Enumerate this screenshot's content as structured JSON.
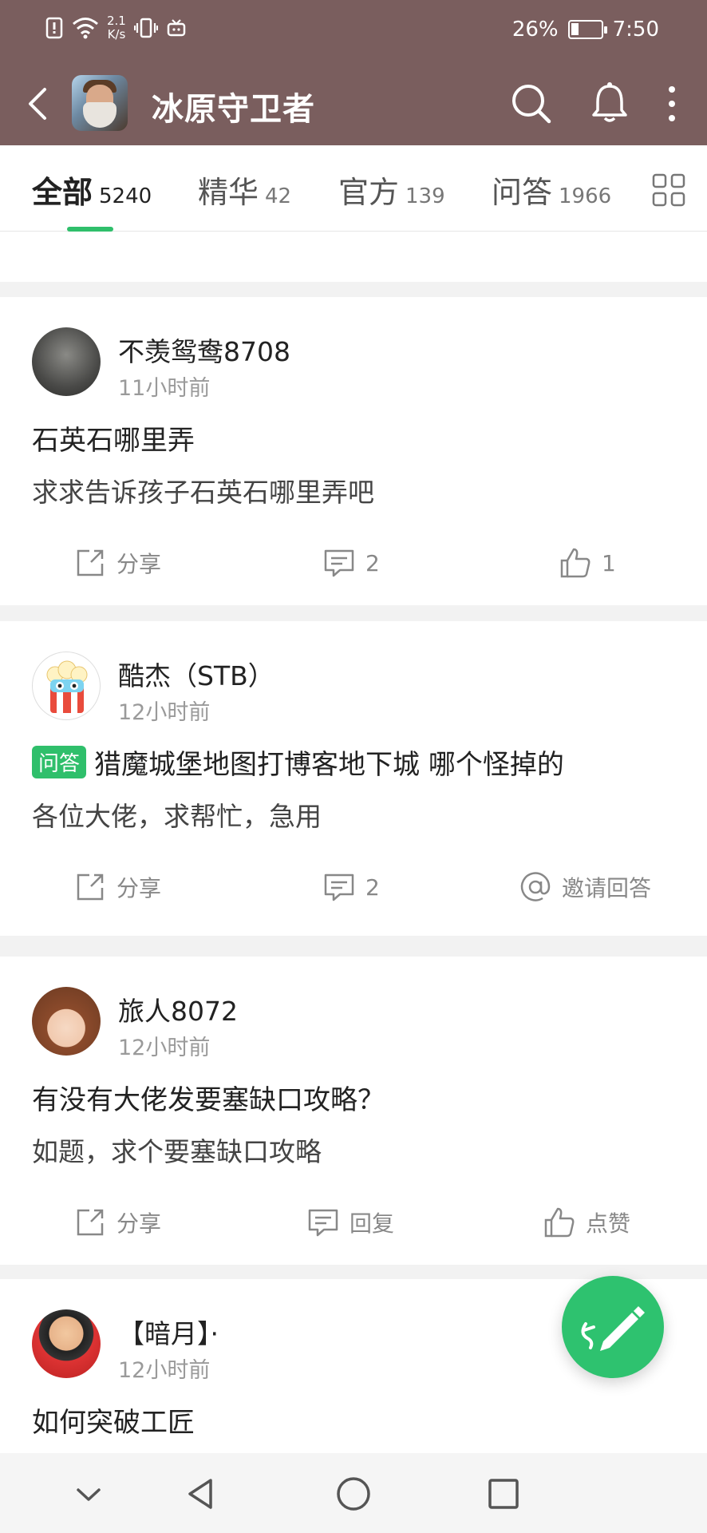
{
  "status": {
    "speed_top": "2.1",
    "speed_bottom": "K/s",
    "battery": "26%",
    "battery_level": 0.26,
    "time": "7:50"
  },
  "header": {
    "title": "冰原守卫者",
    "icon": "game-avatar"
  },
  "tabs": [
    {
      "label": "全部",
      "count": "5240",
      "active": true
    },
    {
      "label": "精华",
      "count": "42"
    },
    {
      "label": "官方",
      "count": "139"
    },
    {
      "label": "问答",
      "count": "1966"
    }
  ],
  "posts": [
    {
      "user": "不羡鸳鸯8708",
      "time": "11小时前",
      "title": "石英石哪里弄",
      "body": "求求告诉孩子石英石哪里弄吧",
      "actions": {
        "share": "分享",
        "comments": "2",
        "likes": "1"
      }
    },
    {
      "user": "酷杰（STB）",
      "time": "12小时前",
      "tag": "问答",
      "title": "猎魔城堡地图打博客地下城 哪个怪掉的",
      "body": "各位大佬，求帮忙，急用",
      "actions": {
        "share": "分享",
        "comments": "2",
        "invite": "邀请回答"
      }
    },
    {
      "user": "旅人8072",
      "time": "12小时前",
      "title": "有没有大佬发要塞缺口攻略？",
      "body": "如题，求个要塞缺口攻略",
      "actions": {
        "share": "分享",
        "reply": "回复",
        "like": "点赞"
      }
    },
    {
      "user": "【暗月】·",
      "time": "12小时前",
      "title": "如何突破工匠"
    }
  ],
  "colors": {
    "header_bg": "#7a5e5e",
    "accent": "#2fbf6b"
  }
}
